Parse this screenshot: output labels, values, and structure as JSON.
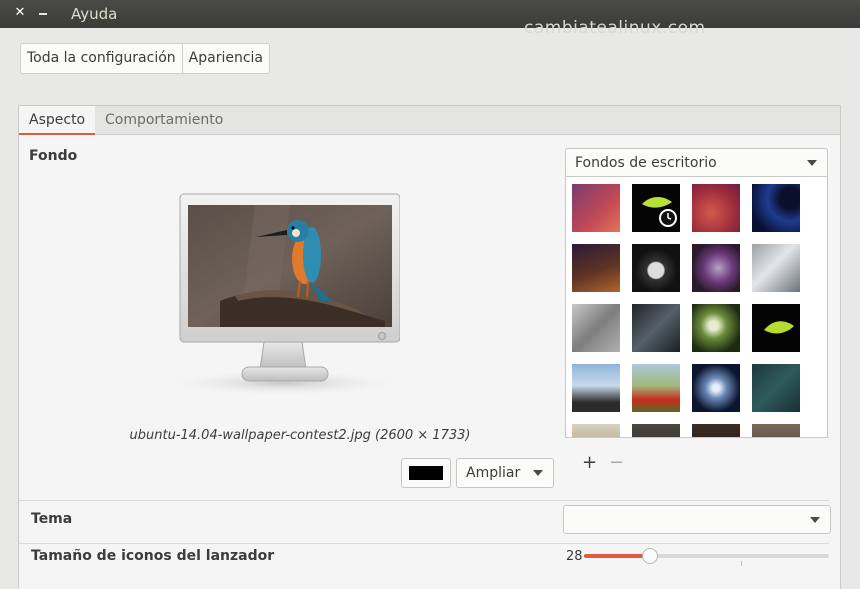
{
  "window": {
    "title": "Ayuda",
    "close_glyph": "✕",
    "watermark": "cambiatealinux.com"
  },
  "breadcrumbs": [
    "Toda la configuración",
    "Apariencia"
  ],
  "tabs": {
    "active": "Aspecto",
    "inactive": "Comportamiento"
  },
  "background": {
    "label": "Fondo",
    "source": "Fondos de escritorio",
    "filename": "ubuntu-14.04-wallpaper-contest2.jpg (2600 × 1733)",
    "color": "#000000",
    "mode": "Ampliar",
    "add_glyph": "+",
    "remove_glyph": "−",
    "thumbnails": [
      "wallpaper-warty-gradient",
      "wallpaper-green-leaf-clock",
      "wallpaper-red-abstract",
      "wallpaper-blue-planet",
      "wallpaper-orange-night-sky",
      "wallpaper-pocket-watch",
      "wallpaper-purple-bokeh",
      "wallpaper-frosted-plant",
      "wallpaper-grey-ice",
      "wallpaper-dark-foliage",
      "wallpaper-water-drop",
      "wallpaper-green-leaf",
      "wallpaper-blue-clouds",
      "wallpaper-red-poppies",
      "wallpaper-galaxy",
      "wallpaper-teal-texture"
    ]
  },
  "theme": {
    "label": "Tema",
    "value": ""
  },
  "launcher": {
    "label": "Tamaño de iconos del lanzador",
    "value": "28",
    "fraction": 0.27
  },
  "colors": {
    "accent": "#e05a40"
  }
}
